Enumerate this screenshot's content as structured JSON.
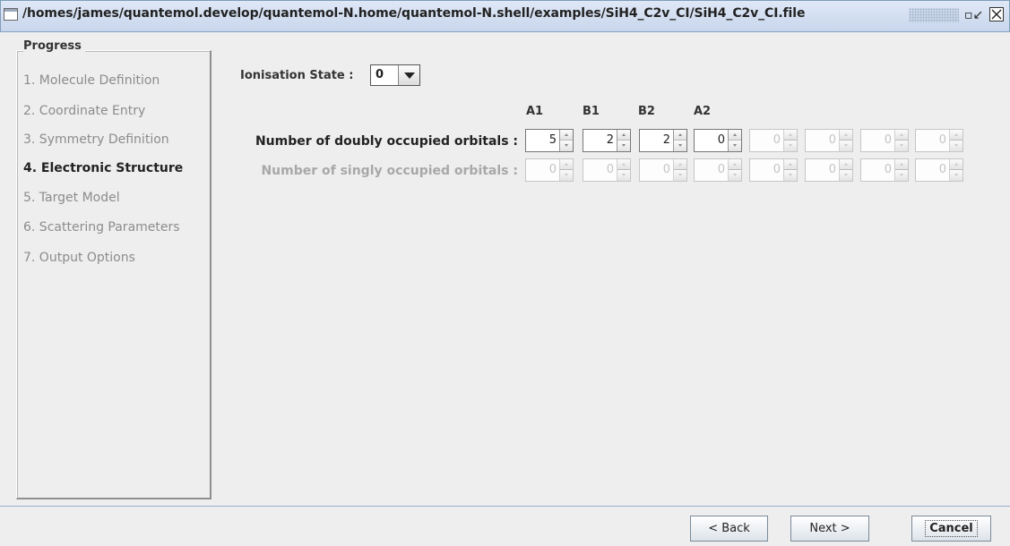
{
  "window": {
    "title": "/homes/james/quantemol.develop/quantemol-N.home/quantemol-N.shell/examples/SiH4_C2v_CI/SiH4_C2v_CI.file"
  },
  "progress": {
    "title": "Progress",
    "steps": [
      {
        "label": "1. Molecule Definition",
        "active": false
      },
      {
        "label": "2. Coordinate Entry",
        "active": false
      },
      {
        "label": "3. Symmetry Definition",
        "active": false
      },
      {
        "label": "4. Electronic Structure",
        "active": true
      },
      {
        "label": "5. Target Model",
        "active": false
      },
      {
        "label": "6. Scattering Parameters",
        "active": false
      },
      {
        "label": "7. Output Options",
        "active": false
      }
    ]
  },
  "ionisation": {
    "label": "Ionisation State :",
    "value": "0"
  },
  "symmetries": [
    "A1",
    "B1",
    "B2",
    "A2"
  ],
  "doubly": {
    "label": "Number of doubly occupied orbitals :",
    "values": [
      "5",
      "2",
      "2",
      "0",
      "0",
      "0",
      "0",
      "0"
    ],
    "enabled": [
      true,
      true,
      true,
      true,
      false,
      false,
      false,
      false
    ]
  },
  "singly": {
    "label": "Number of singly occupied orbitals :",
    "values": [
      "0",
      "0",
      "0",
      "0",
      "0",
      "0",
      "0",
      "0"
    ],
    "enabled": [
      false,
      false,
      false,
      false,
      false,
      false,
      false,
      false
    ]
  },
  "buttons": {
    "back": "< Back",
    "next": "Next >",
    "cancel": "Cancel"
  },
  "colors": {
    "active_text": "#222222",
    "disabled_text": "#8c8c8c",
    "titlebar": "#c8d6ec"
  },
  "icons": [
    "window-icon",
    "restore-icon",
    "close-icon",
    "dropdown-arrow-icon",
    "spin-up-icon",
    "spin-down-icon"
  ]
}
